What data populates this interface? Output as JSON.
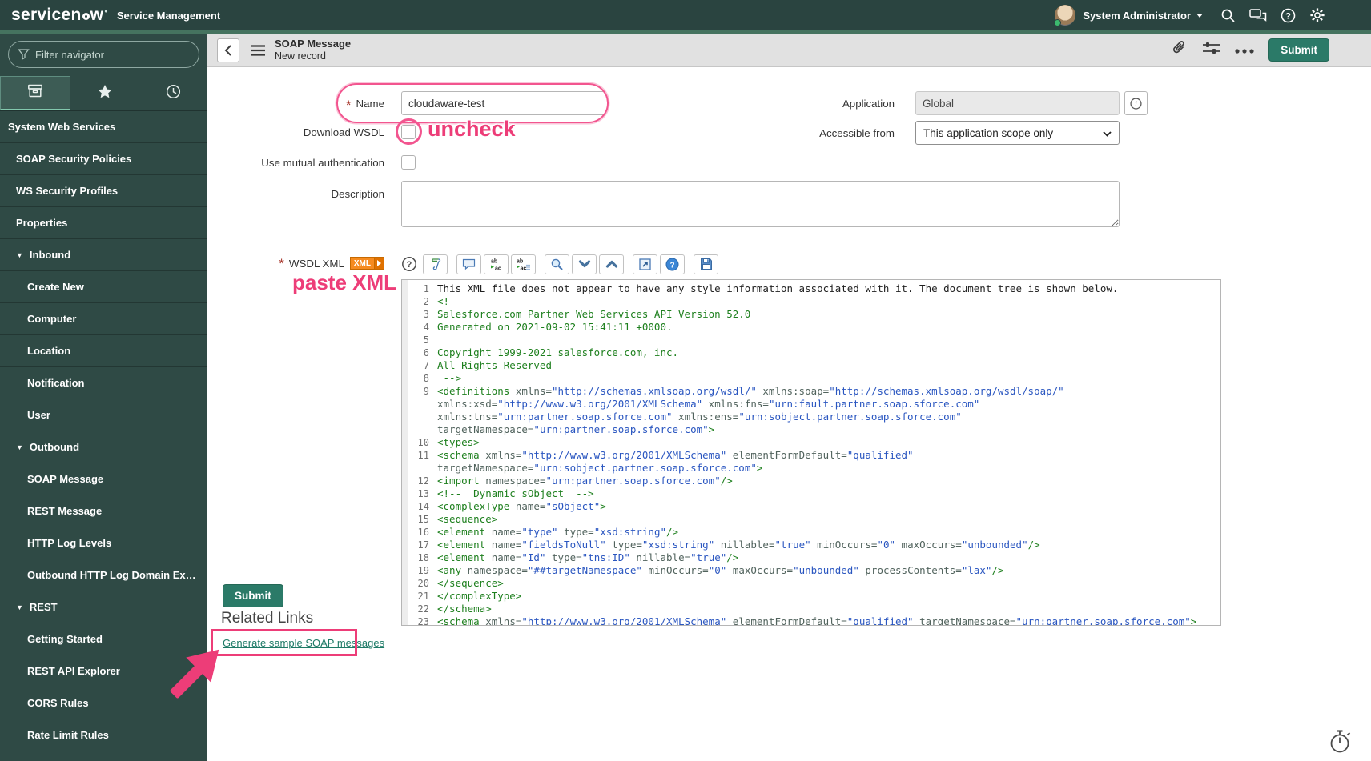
{
  "header": {
    "logo_text_left": "servicen",
    "logo_text_right": "w",
    "product": "Service Management",
    "user": "System Administrator"
  },
  "sidebar": {
    "filter_placeholder": "Filter navigator",
    "items": [
      {
        "label": "System Web Services",
        "level": 0
      },
      {
        "label": "SOAP Security Policies",
        "level": 1
      },
      {
        "label": "WS Security Profiles",
        "level": 1
      },
      {
        "label": "Properties",
        "level": 1
      },
      {
        "label": "Inbound",
        "level": 1,
        "group": true
      },
      {
        "label": "Create New",
        "level": 2
      },
      {
        "label": "Computer",
        "level": 2
      },
      {
        "label": "Location",
        "level": 2
      },
      {
        "label": "Notification",
        "level": 2
      },
      {
        "label": "User",
        "level": 2
      },
      {
        "label": "Outbound",
        "level": 1,
        "group": true
      },
      {
        "label": "SOAP Message",
        "level": 2
      },
      {
        "label": "REST Message",
        "level": 2
      },
      {
        "label": "HTTP Log Levels",
        "level": 2
      },
      {
        "label": "Outbound HTTP Log Domain Ex…",
        "level": 2
      },
      {
        "label": "REST",
        "level": 1,
        "group": true
      },
      {
        "label": "Getting Started",
        "level": 2
      },
      {
        "label": "REST API Explorer",
        "level": 2
      },
      {
        "label": "CORS Rules",
        "level": 2
      },
      {
        "label": "Rate Limit Rules",
        "level": 2
      }
    ]
  },
  "form_header": {
    "title": "SOAP Message",
    "subtitle": "New record",
    "submit_label": "Submit"
  },
  "form": {
    "name_label": "Name",
    "name_value": "cloudaware-test",
    "application_label": "Application",
    "application_value": "Global",
    "download_wsdl_label": "Download WSDL",
    "accessible_label": "Accessible from",
    "accessible_value": "This application scope only",
    "mutual_auth_label": "Use mutual authentication",
    "description_label": "Description",
    "wsdl_label": "WSDL XML",
    "wsdl_badge": "XML",
    "submit_label": "Submit"
  },
  "wsdl_toolbar": {
    "buttons": [
      {
        "icon": "script",
        "gap": false
      },
      {
        "icon": "comment",
        "gap": true
      },
      {
        "icon": "replace",
        "gap": false
      },
      {
        "icon": "replace-all",
        "gap": false
      },
      {
        "icon": "find",
        "gap": true
      },
      {
        "icon": "chevron-down",
        "gap": false
      },
      {
        "icon": "chevron-up",
        "gap": false
      },
      {
        "icon": "open-window",
        "gap": true
      },
      {
        "icon": "help",
        "gap": false
      },
      {
        "icon": "save",
        "gap": true
      }
    ]
  },
  "editor": {
    "lines": [
      {
        "n": 1,
        "type": "plain",
        "text": "This XML file does not appear to have any style information associated with it. The document tree is shown below."
      },
      {
        "n": 2,
        "type": "comment",
        "text": "<!--"
      },
      {
        "n": 3,
        "type": "comment",
        "text": "Salesforce.com Partner Web Services API Version 52.0"
      },
      {
        "n": 4,
        "type": "comment",
        "text": "Generated on 2021-09-02 15:41:11 +0000."
      },
      {
        "n": 5,
        "type": "comment",
        "text": ""
      },
      {
        "n": 6,
        "type": "comment",
        "text": "Copyright 1999-2021 salesforce.com, inc."
      },
      {
        "n": 7,
        "type": "comment",
        "text": "All Rights Reserved"
      },
      {
        "n": 8,
        "type": "comment",
        "text": " -->"
      },
      {
        "n": 9,
        "type": "markup",
        "text": "<definitions xmlns=\"http://schemas.xmlsoap.org/wsdl/\" xmlns:soap=\"http://schemas.xmlsoap.org/wsdl/soap/\" xmlns:xsd=\"http://www.w3.org/2001/XMLSchema\" xmlns:fns=\"urn:fault.partner.soap.sforce.com\" xmlns:tns=\"urn:partner.soap.sforce.com\" xmlns:ens=\"urn:sobject.partner.soap.sforce.com\" targetNamespace=\"urn:partner.soap.sforce.com\">"
      },
      {
        "n": 10,
        "type": "markup",
        "text": "<types>"
      },
      {
        "n": 11,
        "type": "markup",
        "text": "<schema xmlns=\"http://www.w3.org/2001/XMLSchema\" elementFormDefault=\"qualified\" targetNamespace=\"urn:sobject.partner.soap.sforce.com\">"
      },
      {
        "n": 12,
        "type": "markup",
        "text": "<import namespace=\"urn:partner.soap.sforce.com\"/>"
      },
      {
        "n": 13,
        "type": "comment",
        "text": "<!--  Dynamic sObject  -->"
      },
      {
        "n": 14,
        "type": "markup",
        "text": "<complexType name=\"sObject\">"
      },
      {
        "n": 15,
        "type": "markup",
        "text": "<sequence>"
      },
      {
        "n": 16,
        "type": "markup",
        "text": "<element name=\"type\" type=\"xsd:string\"/>"
      },
      {
        "n": 17,
        "type": "markup",
        "text": "<element name=\"fieldsToNull\" type=\"xsd:string\" nillable=\"true\" minOccurs=\"0\" maxOccurs=\"unbounded\"/>"
      },
      {
        "n": 18,
        "type": "markup",
        "text": "<element name=\"Id\" type=\"tns:ID\" nillable=\"true\"/>"
      },
      {
        "n": 19,
        "type": "markup",
        "text": "<any namespace=\"##targetNamespace\" minOccurs=\"0\" maxOccurs=\"unbounded\" processContents=\"lax\"/>"
      },
      {
        "n": 20,
        "type": "markup",
        "text": "</sequence>"
      },
      {
        "n": 21,
        "type": "markup",
        "text": "</complexType>"
      },
      {
        "n": 22,
        "type": "markup",
        "text": "</schema>"
      },
      {
        "n": 23,
        "type": "markup",
        "text": "<schema xmlns=\"http://www.w3.org/2001/XMLSchema\" elementFormDefault=\"qualified\" targetNamespace=\"urn:partner.soap.sforce.com\">"
      }
    ]
  },
  "related": {
    "heading": "Related Links",
    "link": "Generate sample SOAP messages"
  },
  "annotations": {
    "uncheck": "uncheck",
    "paste": "paste XML",
    "accent_pink": "#ed3d78"
  },
  "colors": {
    "banner": "#2a4440",
    "accent_strip": "#45735f",
    "sidebar": "#2f4a45",
    "button_green": "#2b7a68",
    "link_teal": "#1d7a66",
    "badge_orange": "#f68b1f"
  }
}
